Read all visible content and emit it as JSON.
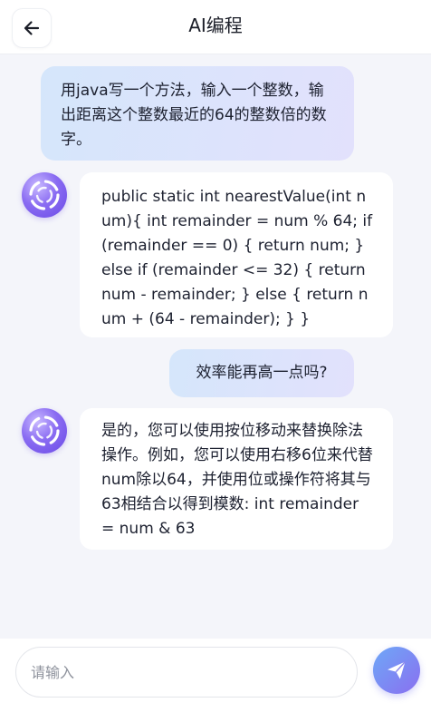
{
  "header": {
    "title": "AI编程"
  },
  "messages": [
    {
      "role": "user",
      "text": "用java写一个方法，输入一个整数，输出距离这个整数最近的64的整数倍的数字。"
    },
    {
      "role": "assistant",
      "text": "public static int nearestValue(int num){ int remainder = num % 64; if (remainder == 0) { return num; } else if (remainder <= 32) { return num - remainder; } else { return num + (64 - remainder); } }"
    },
    {
      "role": "user",
      "text": "效率能再高一点吗?"
    },
    {
      "role": "assistant",
      "text": "是的，您可以使用按位移动来替换除法操作。例如，您可以使用右移6位来代替num除以64，并使用位或操作符将其与63相结合以得到模数: int remainder = num & 63"
    }
  ],
  "composer": {
    "placeholder": "请输入",
    "value": ""
  },
  "icons": {
    "back": "arrow-left-icon",
    "avatar": "ai-assistant-avatar",
    "send": "paper-plane-icon"
  },
  "colors": {
    "accent": "#7b6ff0",
    "user_bubble": "#d9e3fb",
    "background": "#f4f5fa"
  }
}
